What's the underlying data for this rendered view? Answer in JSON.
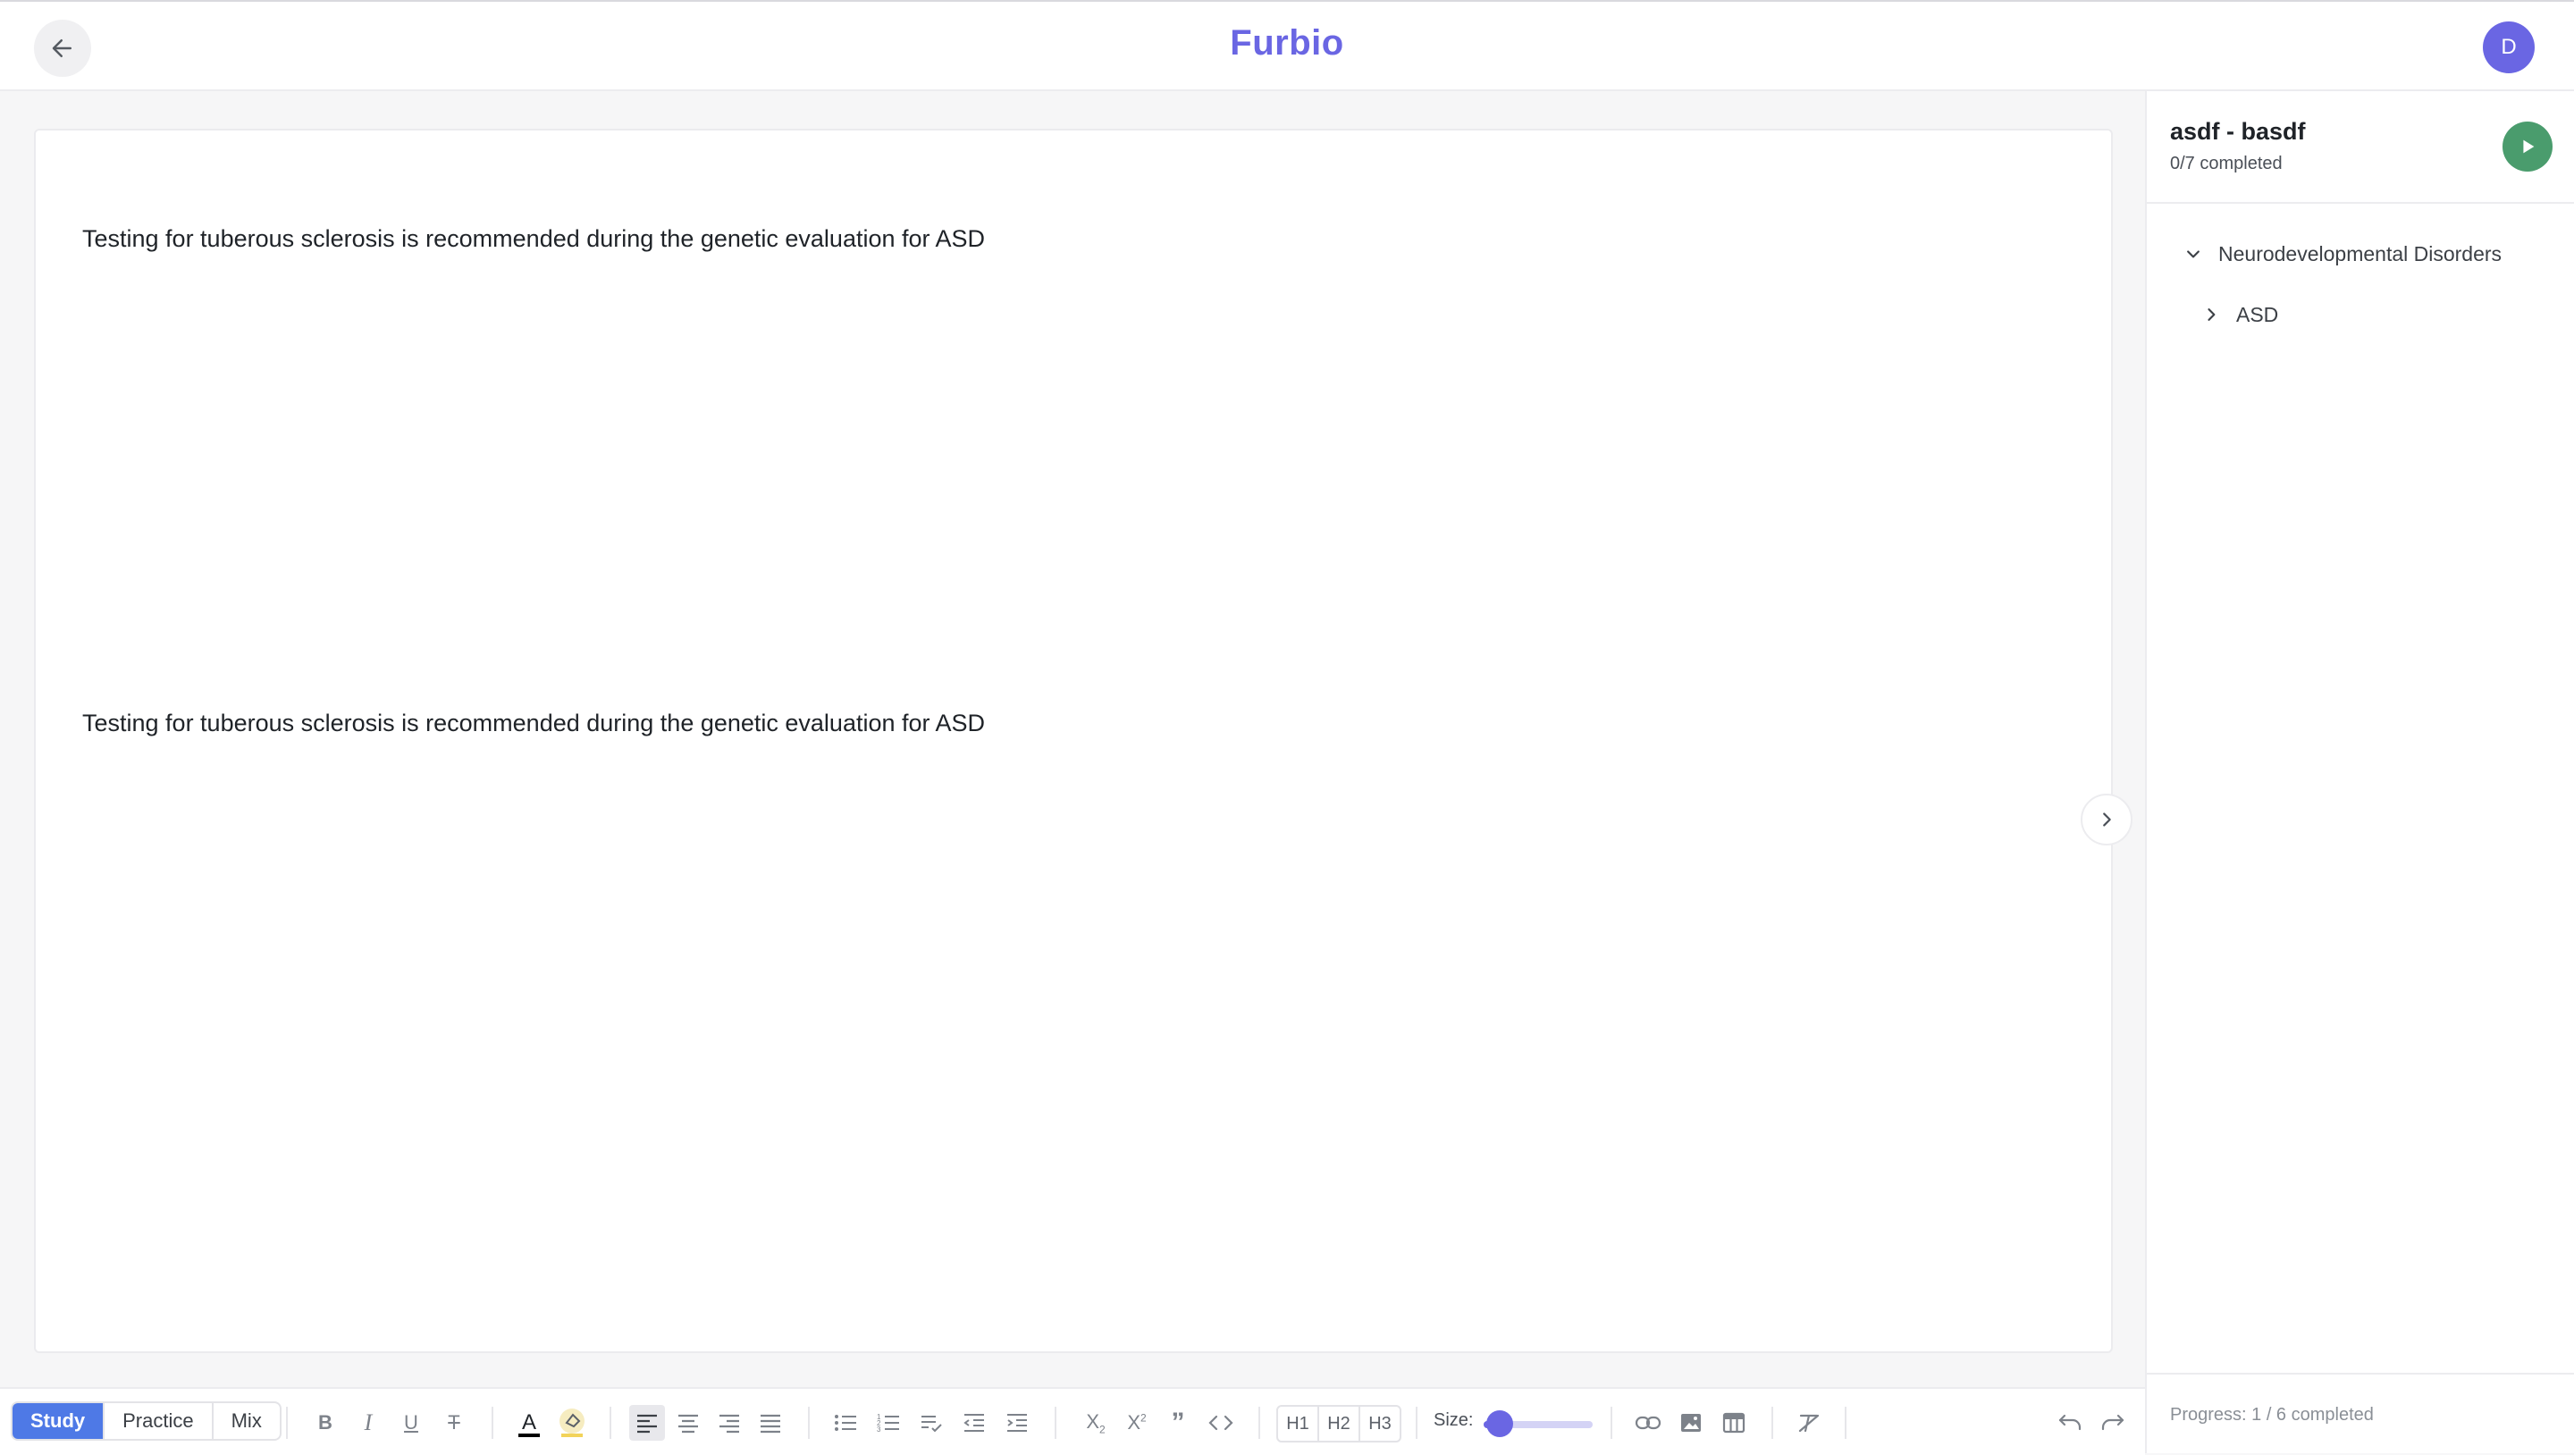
{
  "app": {
    "title": "Furbio",
    "avatar_initial": "D"
  },
  "editor": {
    "paragraphs": [
      "Testing for tuberous sclerosis is recommended during the genetic evaluation for ASD",
      "Testing for tuberous sclerosis is recommended during the genetic evaluation for ASD"
    ]
  },
  "side_panel": {
    "course_title": "asdf - basdf",
    "course_progress": "0/7 completed",
    "tree": [
      {
        "label": "Neurodevelopmental Disorders",
        "expanded": true,
        "level": 0
      },
      {
        "label": "ASD",
        "expanded": false,
        "level": 1
      }
    ],
    "footer_progress": "Progress: 1 / 6 completed"
  },
  "toolbar": {
    "modes": [
      "Study",
      "Practice",
      "Mix"
    ],
    "active_mode": "Study",
    "headings": [
      "H1",
      "H2",
      "H3"
    ],
    "size_label": "Size:",
    "size_level": 0.15,
    "active_alignment": "align-left",
    "icons": [
      "bold-icon",
      "italic-icon",
      "underline-icon",
      "strikethrough-icon",
      "text-color-icon",
      "highlight-icon",
      "align-left-icon",
      "align-center-icon",
      "align-right-icon",
      "align-justify-icon",
      "bullet-list-icon",
      "numbered-list-icon",
      "task-list-icon",
      "outdent-icon",
      "indent-icon",
      "subscript-icon",
      "superscript-icon",
      "blockquote-icon",
      "code-icon",
      "link-icon",
      "image-icon",
      "table-icon",
      "clear-format-icon",
      "undo-icon",
      "redo-icon"
    ]
  },
  "colors": {
    "brand": "#6a66e3",
    "active_mode": "#4e79e6",
    "play": "#4a9c6d",
    "text_color_bar": "#000000",
    "highlight_bar": "#f2d35a"
  }
}
